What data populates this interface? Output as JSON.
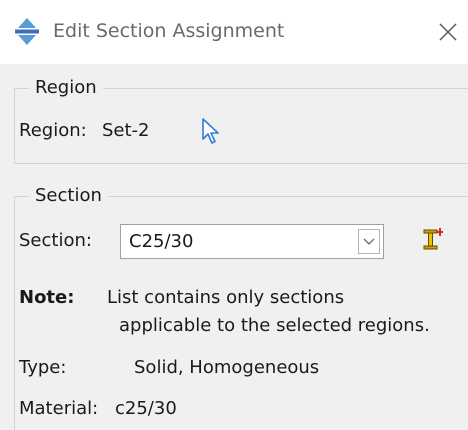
{
  "window": {
    "title": "Edit Section Assignment",
    "title_icon": "section-assignment-icon",
    "close_icon": "close-icon"
  },
  "region_group": {
    "legend": "Region",
    "region_label": "Region:",
    "region_value": "Set-2",
    "pick_icon": "cursor-arrow-icon"
  },
  "section_group": {
    "legend": "Section",
    "section_label": "Section:",
    "section_value": "C25/30",
    "dropdown_icon": "chevron-down-icon",
    "edit_icon": "section-manager-icon",
    "note_label": "Note:",
    "note_line1": "List contains only sections",
    "note_line2": "applicable to the selected regions.",
    "type_label": "Type:",
    "type_value": "Solid, Homogeneous",
    "material_label": "Material:",
    "material_value": "c25/30"
  },
  "colors": {
    "title_text": "#6a6a6a",
    "panel_bg": "#f0f0f0",
    "icon_blue": "#3a7bd5",
    "icon_red": "#d62b1f",
    "icon_yellow": "#f2c200"
  }
}
